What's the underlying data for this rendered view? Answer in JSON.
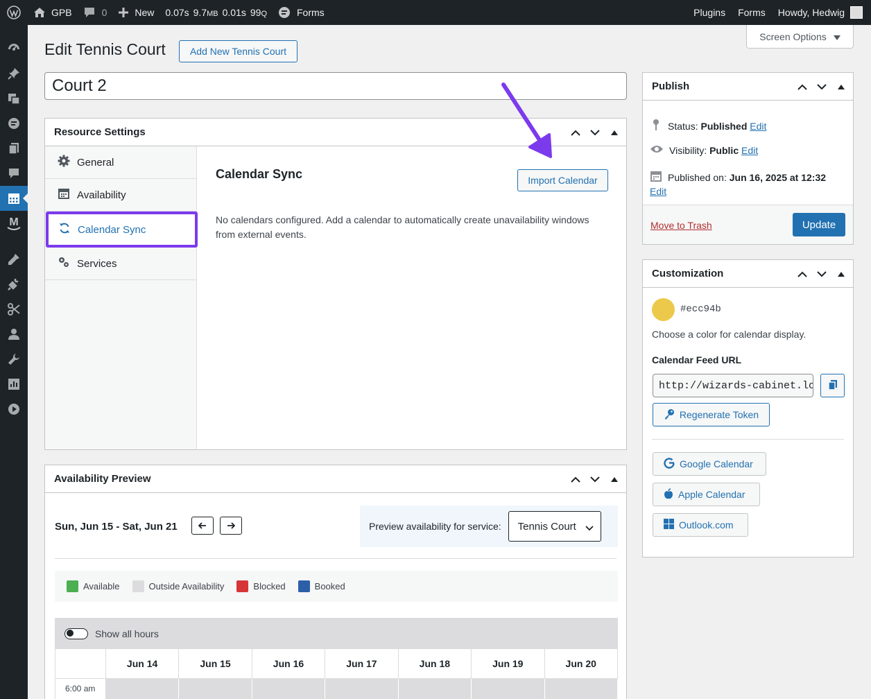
{
  "adminbar": {
    "site_name": "GPB",
    "comments_count": "0",
    "new_label": "New",
    "perf_time": "0.07s",
    "perf_mem": "9.7",
    "perf_mem_unit": "MB",
    "perf_db_time": "0.01s",
    "perf_queries": "99",
    "perf_queries_unit": "Q",
    "forms_label": "Forms",
    "right_items": [
      "Plugins",
      "Forms"
    ],
    "greeting": "Howdy, Hedwig"
  },
  "sidebar": {
    "icons": [
      "dashboard-icon",
      "pin-icon",
      "media-icon",
      "forms-icon",
      "pages-icon",
      "comments-icon",
      "calendar-icon",
      "m-logo-icon",
      "appearance-icon",
      "plugins-icon",
      "tools-icon",
      "users-icon",
      "settings-wrench-icon",
      "layout-icon",
      "play-icon"
    ],
    "active": "calendar-icon"
  },
  "header": {
    "title": "Edit Tennis Court",
    "add_new_label": "Add New Tennis Court",
    "screen_options_label": "Screen Options"
  },
  "post_title": "Court 2",
  "resource_settings": {
    "title": "Resource Settings",
    "tabs": [
      {
        "label": "General",
        "icon": "gear-icon"
      },
      {
        "label": "Availability",
        "icon": "calendar-icon"
      },
      {
        "label": "Calendar Sync",
        "icon": "sync-icon"
      },
      {
        "label": "Services",
        "icon": "gears-icon"
      }
    ],
    "active_tab": "Calendar Sync",
    "content_title": "Calendar Sync",
    "import_label": "Import Calendar",
    "description": "No calendars configured. Add a calendar to automatically create unavailability windows from external events."
  },
  "preview": {
    "title": "Availability Preview",
    "range": "Sun, Jun 15 - Sat, Jun 21",
    "service_label": "Preview availability for service:",
    "service_value": "Tennis Court",
    "legend": [
      {
        "label": "Available",
        "color": "#4caf50"
      },
      {
        "label": "Outside Availability",
        "color": "#dcdcde"
      },
      {
        "label": "Blocked",
        "color": "#d63638"
      },
      {
        "label": "Booked",
        "color": "#2c5fa8"
      }
    ],
    "show_all_hours_label": "Show all hours",
    "days": [
      "Jun 14",
      "Jun 15",
      "Jun 16",
      "Jun 17",
      "Jun 18",
      "Jun 19",
      "Jun 20"
    ],
    "first_row_time": "6:00 am"
  },
  "publish": {
    "title": "Publish",
    "status_label": "Status:",
    "status_value": "Published",
    "visibility_label": "Visibility:",
    "visibility_value": "Public",
    "published_label": "Published on:",
    "published_value": "Jun 16, 2025 at 12:32",
    "edit_label": "Edit",
    "trash_label": "Move to Trash",
    "update_label": "Update"
  },
  "customization": {
    "title": "Customization",
    "color_hex": "#ecc94b",
    "color_desc": "Choose a color for calendar display.",
    "feed_label": "Calendar Feed URL",
    "feed_url": "http://wizards-cabinet.lo",
    "regen_label": "Regenerate Token",
    "google_label": "Google Calendar",
    "apple_label": "Apple Calendar",
    "outlook_label": "Outlook.com"
  },
  "colors": {
    "accent": "#2271b1",
    "highlight": "#7c3aed",
    "admin_bar": "#1d2327"
  }
}
